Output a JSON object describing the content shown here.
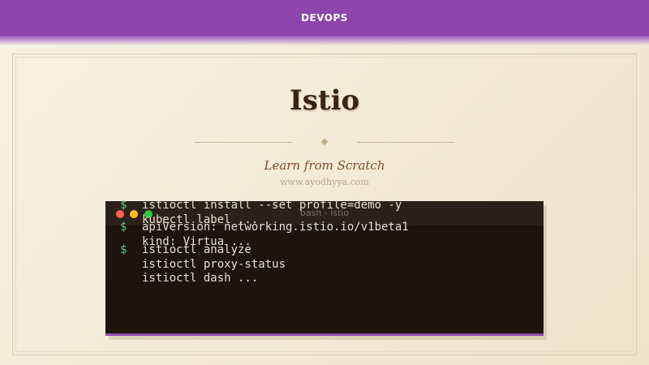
{
  "header": {
    "brand": "DEVOPS"
  },
  "hero": {
    "title": "Istio",
    "subtitle": "Learn from Scratch",
    "website": "www.ayodhyya.com"
  },
  "terminal": {
    "window_title": "bash - istio",
    "prompt_symbol": "$",
    "lines": [
      "istioctl install --set profile=demo -y",
      "kubectl label ...",
      "apiVersion: networking.istio.io/v1beta1",
      "kind: Virtua ...",
      "istioctl analyze",
      "istioctl proxy-status",
      "istioctl dash ..."
    ]
  },
  "colors": {
    "accent": "#8e44ad",
    "background": "#f5ecdc",
    "title": "#3b2412",
    "terminal_bg": "#1d140d",
    "prompt": "#5fc777"
  }
}
